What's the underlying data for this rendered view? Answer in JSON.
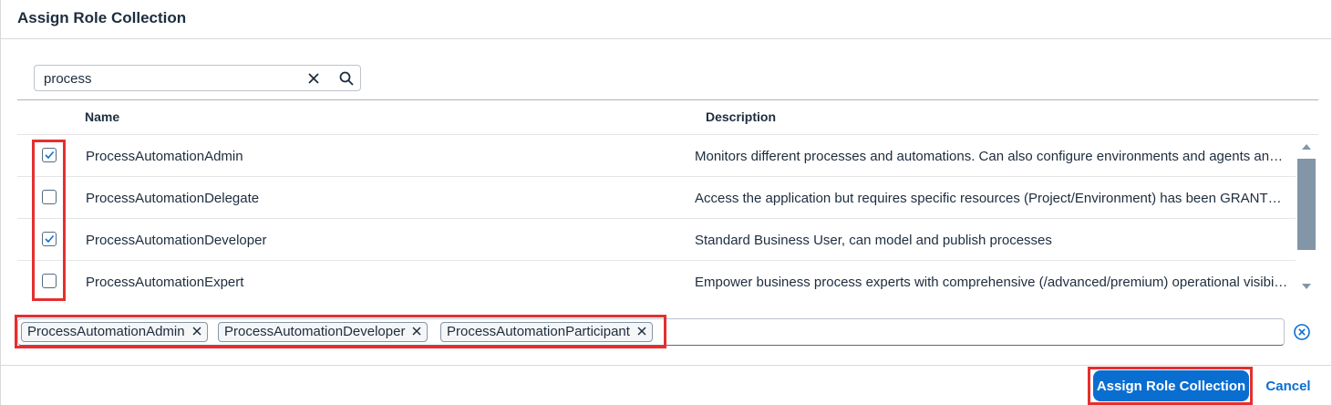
{
  "dialog": {
    "title": "Assign Role Collection"
  },
  "search": {
    "value": "process",
    "clear_icon": "close-icon",
    "search_icon": "search-icon"
  },
  "table": {
    "columns": [
      "Name",
      "Description"
    ],
    "rows": [
      {
        "checked": true,
        "name": "ProcessAutomationAdmin",
        "description": "Monitors different processes and automations. Can also configure environments and agents and manage access."
      },
      {
        "checked": false,
        "name": "ProcessAutomationDelegate",
        "description": "Access the application but requires specific resources (Project/Environment) has been GRANTED to them."
      },
      {
        "checked": true,
        "name": "ProcessAutomationDeveloper",
        "description": "Standard Business User, can model and publish processes"
      },
      {
        "checked": false,
        "name": "ProcessAutomationExpert",
        "description": "Empower business process experts with comprehensive (/advanced/premium) operational visibility."
      }
    ]
  },
  "tokens": [
    {
      "label": "ProcessAutomationAdmin"
    },
    {
      "label": "ProcessAutomationDeveloper"
    },
    {
      "label": "ProcessAutomationParticipant"
    }
  ],
  "footer": {
    "assign_label": "Assign Role Collection",
    "cancel_label": "Cancel"
  },
  "colors": {
    "accent": "#0a6ed1",
    "highlight": "#e52f2f",
    "scrollbar": "#8396a8"
  }
}
